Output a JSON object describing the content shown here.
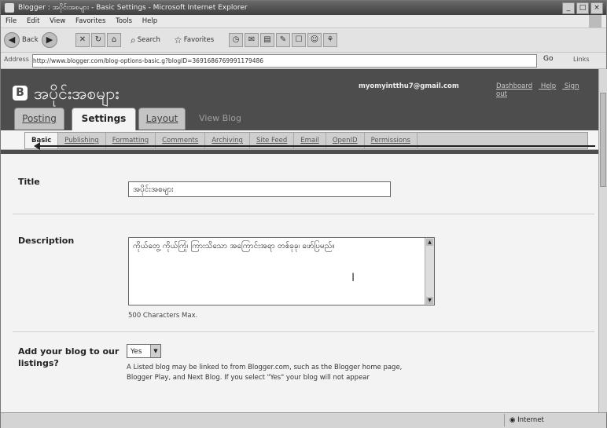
{
  "window": {
    "title": "Blogger : အပိုင်းအစများ - Basic Settings - Microsoft Internet Explorer",
    "controls": [
      "_",
      "□",
      "×"
    ]
  },
  "menu": [
    "File",
    "Edit",
    "View",
    "Favorites",
    "Tools",
    "Help"
  ],
  "toolbar": {
    "back": "Back",
    "search": "Search",
    "favorites": "Favorites"
  },
  "address": {
    "label": "Address",
    "url": "http://www.blogger.com/blog-options-basic.g?blogID=3691686769991179486",
    "go": "Go",
    "links": "Links"
  },
  "blogger": {
    "logo_letter": "B",
    "blog_name": "အပိုင်းအစများ",
    "user_email": "myomyintthu7@gmail.com",
    "header_links": [
      "Dashboard",
      "Help",
      "Sign out"
    ]
  },
  "main_tabs": {
    "posting": "Posting",
    "settings": "Settings",
    "layout": "Layout",
    "view_blog": "View Blog"
  },
  "sub_tabs": [
    "Basic",
    "Publishing",
    "Formatting",
    "Comments",
    "Archiving",
    "Site Feed",
    "Email",
    "OpenID",
    "Permissions"
  ],
  "form": {
    "title_label": "Title",
    "title_value": "အပိုင်းအစများ",
    "description_label": "Description",
    "description_value": "ကိုယ်တွေ့ ကိုယ်ကြုံ၊ ကြားသိသော အကြောင်းအရာ တစ်ခုခု၊ ဖော်ပြမည်။",
    "description_hint": "500 Characters Max.",
    "listing_label": "Add your blog to our listings?",
    "listing_value": "Yes",
    "listing_help": "A Listed blog may be linked to from Blogger.com, such as the Blogger home page, Blogger Play, and Next Blog. If you select \"Yes\" your blog will not appear"
  },
  "status": {
    "left": "",
    "zone": "Internet"
  }
}
